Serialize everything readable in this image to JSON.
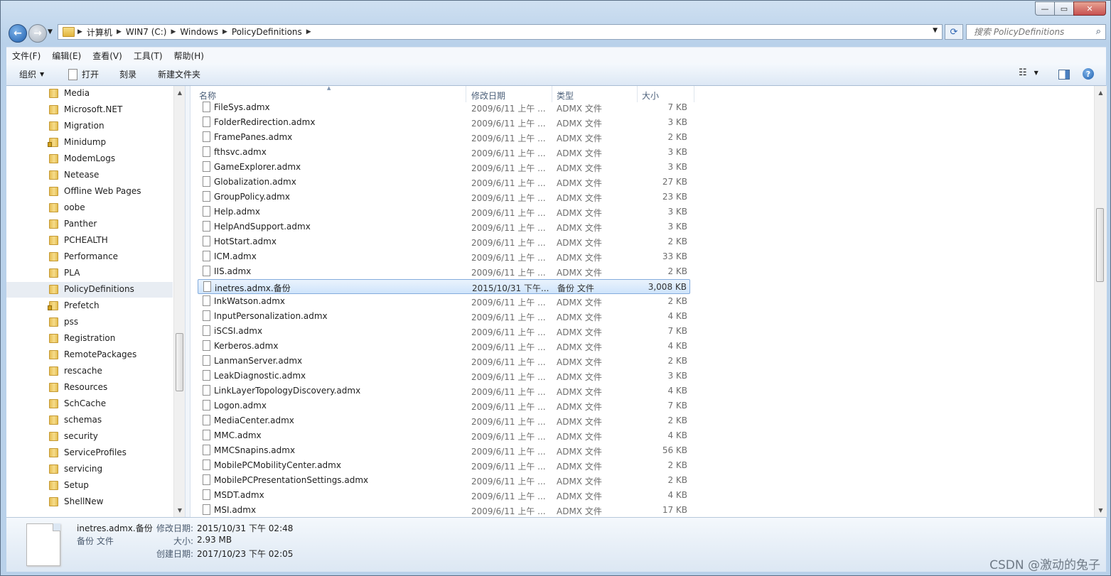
{
  "window": {
    "caption_buttons": [
      "—",
      "▭",
      "✕"
    ]
  },
  "address": {
    "breadcrumbs": [
      "计算机",
      "WIN7 (C:)",
      "Windows",
      "PolicyDefinitions"
    ],
    "search_placeholder": "搜索 PolicyDefinitions"
  },
  "menu": [
    "文件(F)",
    "编辑(E)",
    "查看(V)",
    "工具(T)",
    "帮助(H)"
  ],
  "toolbar": {
    "organize": "组织",
    "open": "打开",
    "burn": "刻录",
    "new_folder": "新建文件夹"
  },
  "nav": {
    "items": [
      {
        "label": "Media"
      },
      {
        "label": "Microsoft.NET"
      },
      {
        "label": "Migration"
      },
      {
        "label": "Minidump",
        "locked": true
      },
      {
        "label": "ModemLogs"
      },
      {
        "label": "Netease"
      },
      {
        "label": "Offline Web Pages"
      },
      {
        "label": "oobe"
      },
      {
        "label": "Panther"
      },
      {
        "label": "PCHEALTH"
      },
      {
        "label": "Performance"
      },
      {
        "label": "PLA"
      },
      {
        "label": "PolicyDefinitions",
        "selected": true
      },
      {
        "label": "Prefetch",
        "locked": true
      },
      {
        "label": "pss"
      },
      {
        "label": "Registration"
      },
      {
        "label": "RemotePackages"
      },
      {
        "label": "rescache"
      },
      {
        "label": "Resources"
      },
      {
        "label": "SchCache"
      },
      {
        "label": "schemas"
      },
      {
        "label": "security"
      },
      {
        "label": "ServiceProfiles"
      },
      {
        "label": "servicing"
      },
      {
        "label": "Setup"
      },
      {
        "label": "ShellNew"
      }
    ]
  },
  "columns": {
    "name": "名称",
    "date": "修改日期",
    "type": "类型",
    "size": "大小"
  },
  "files": [
    {
      "name": "FileSys.admx",
      "date": "2009/6/11 上午 ...",
      "type": "ADMX 文件",
      "size": "7 KB"
    },
    {
      "name": "FolderRedirection.admx",
      "date": "2009/6/11 上午 ...",
      "type": "ADMX 文件",
      "size": "3 KB"
    },
    {
      "name": "FramePanes.admx",
      "date": "2009/6/11 上午 ...",
      "type": "ADMX 文件",
      "size": "2 KB"
    },
    {
      "name": "fthsvc.admx",
      "date": "2009/6/11 上午 ...",
      "type": "ADMX 文件",
      "size": "3 KB"
    },
    {
      "name": "GameExplorer.admx",
      "date": "2009/6/11 上午 ...",
      "type": "ADMX 文件",
      "size": "3 KB"
    },
    {
      "name": "Globalization.admx",
      "date": "2009/6/11 上午 ...",
      "type": "ADMX 文件",
      "size": "27 KB"
    },
    {
      "name": "GroupPolicy.admx",
      "date": "2009/6/11 上午 ...",
      "type": "ADMX 文件",
      "size": "23 KB"
    },
    {
      "name": "Help.admx",
      "date": "2009/6/11 上午 ...",
      "type": "ADMX 文件",
      "size": "3 KB"
    },
    {
      "name": "HelpAndSupport.admx",
      "date": "2009/6/11 上午 ...",
      "type": "ADMX 文件",
      "size": "3 KB"
    },
    {
      "name": "HotStart.admx",
      "date": "2009/6/11 上午 ...",
      "type": "ADMX 文件",
      "size": "2 KB"
    },
    {
      "name": "ICM.admx",
      "date": "2009/6/11 上午 ...",
      "type": "ADMX 文件",
      "size": "33 KB"
    },
    {
      "name": "IIS.admx",
      "date": "2009/6/11 上午 ...",
      "type": "ADMX 文件",
      "size": "2 KB"
    },
    {
      "name": "inetres.admx.备份",
      "date": "2015/10/31 下午...",
      "type": "备份 文件",
      "size": "3,008 KB",
      "selected": true
    },
    {
      "name": "InkWatson.admx",
      "date": "2009/6/11 上午 ...",
      "type": "ADMX 文件",
      "size": "2 KB"
    },
    {
      "name": "InputPersonalization.admx",
      "date": "2009/6/11 上午 ...",
      "type": "ADMX 文件",
      "size": "4 KB"
    },
    {
      "name": "iSCSI.admx",
      "date": "2009/6/11 上午 ...",
      "type": "ADMX 文件",
      "size": "7 KB"
    },
    {
      "name": "Kerberos.admx",
      "date": "2009/6/11 上午 ...",
      "type": "ADMX 文件",
      "size": "4 KB"
    },
    {
      "name": "LanmanServer.admx",
      "date": "2009/6/11 上午 ...",
      "type": "ADMX 文件",
      "size": "2 KB"
    },
    {
      "name": "LeakDiagnostic.admx",
      "date": "2009/6/11 上午 ...",
      "type": "ADMX 文件",
      "size": "3 KB"
    },
    {
      "name": "LinkLayerTopologyDiscovery.admx",
      "date": "2009/6/11 上午 ...",
      "type": "ADMX 文件",
      "size": "4 KB"
    },
    {
      "name": "Logon.admx",
      "date": "2009/6/11 上午 ...",
      "type": "ADMX 文件",
      "size": "7 KB"
    },
    {
      "name": "MediaCenter.admx",
      "date": "2009/6/11 上午 ...",
      "type": "ADMX 文件",
      "size": "2 KB"
    },
    {
      "name": "MMC.admx",
      "date": "2009/6/11 上午 ...",
      "type": "ADMX 文件",
      "size": "4 KB"
    },
    {
      "name": "MMCSnapins.admx",
      "date": "2009/6/11 上午 ...",
      "type": "ADMX 文件",
      "size": "56 KB"
    },
    {
      "name": "MobilePCMobilityCenter.admx",
      "date": "2009/6/11 上午 ...",
      "type": "ADMX 文件",
      "size": "2 KB"
    },
    {
      "name": "MobilePCPresentationSettings.admx",
      "date": "2009/6/11 上午 ...",
      "type": "ADMX 文件",
      "size": "2 KB"
    },
    {
      "name": "MSDT.admx",
      "date": "2009/6/11 上午 ...",
      "type": "ADMX 文件",
      "size": "4 KB"
    },
    {
      "name": "MSI.admx",
      "date": "2009/6/11 上午 ...",
      "type": "ADMX 文件",
      "size": "17 KB"
    }
  ],
  "details": {
    "name": "inetres.admx.备份",
    "type": "备份 文件",
    "modified_label": "修改日期:",
    "modified_value": "2015/10/31 下午 02:48",
    "size_label": "大小:",
    "size_value": "2.93 MB",
    "created_label": "创建日期:",
    "created_value": "2017/10/23 下午 02:05"
  },
  "watermark": "CSDN @激动的兔子"
}
